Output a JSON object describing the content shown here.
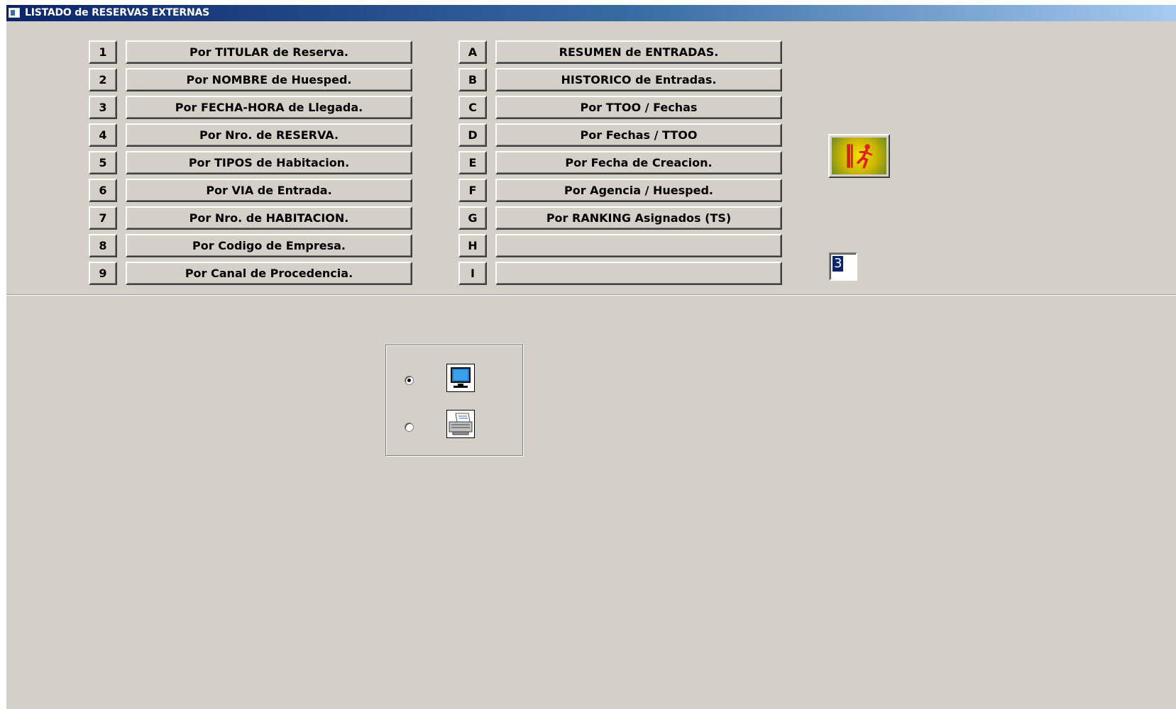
{
  "window": {
    "title": "LISTADO de RESERVAS EXTERNAS"
  },
  "left_column": [
    {
      "key": "1",
      "label": "Por TITULAR de Reserva."
    },
    {
      "key": "2",
      "label": "Por NOMBRE de Huesped."
    },
    {
      "key": "3",
      "label": "Por FECHA-HORA de Llegada."
    },
    {
      "key": "4",
      "label": "Por Nro. de RESERVA."
    },
    {
      "key": "5",
      "label": "Por TIPOS de Habitacion."
    },
    {
      "key": "6",
      "label": "Por VIA de Entrada."
    },
    {
      "key": "7",
      "label": "Por Nro. de HABITACION."
    },
    {
      "key": "8",
      "label": "Por Codigo de Empresa."
    },
    {
      "key": "9",
      "label": "Por Canal de Procedencia."
    }
  ],
  "right_column": [
    {
      "key": "A",
      "label": "RESUMEN de ENTRADAS."
    },
    {
      "key": "B",
      "label": "HISTORICO de Entradas."
    },
    {
      "key": "C",
      "label": "Por TTOO / Fechas"
    },
    {
      "key": "D",
      "label": "Por Fechas / TTOO"
    },
    {
      "key": "E",
      "label": "Por Fecha de Creacion."
    },
    {
      "key": "F",
      "label": "Por Agencia / Huesped."
    },
    {
      "key": "G",
      "label": "Por RANKING Asignados (TS)"
    },
    {
      "key": "H",
      "label": ""
    },
    {
      "key": "I",
      "label": ""
    }
  ],
  "exit_button": {
    "icon": "exit-running-man-icon"
  },
  "copies_field": {
    "value": "3"
  },
  "output": {
    "options": [
      {
        "icon": "monitor-icon",
        "selected": true
      },
      {
        "icon": "printer-icon",
        "selected": false
      }
    ]
  }
}
